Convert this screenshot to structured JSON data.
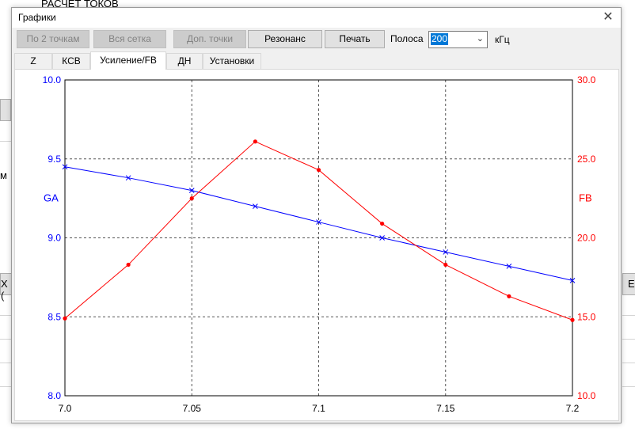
{
  "background_app": {
    "title": "РАСЧЕТ ТОКОВ",
    "fragment_left": "м",
    "fragment_x": "X (",
    "fragment_e": "E"
  },
  "dialog": {
    "title": "Графики",
    "close_icon": "close-icon",
    "toolbar": {
      "by_two_points": "По 2 точкам",
      "whole_grid": "Вся сетка",
      "extra_points": "Доп. точки",
      "resonance": "Резонанс",
      "print": "Печать",
      "band_label": "Полоса",
      "band_value": "200",
      "band_unit": "кГц"
    },
    "tabs": [
      {
        "label": "Z"
      },
      {
        "label": "КСВ"
      },
      {
        "label": "Усиление/FB",
        "active": true
      },
      {
        "label": "ДН"
      },
      {
        "label": "Установки"
      }
    ]
  },
  "chart_data": {
    "type": "line",
    "colors": {
      "ga": "#0000ff",
      "fb": "#ff0000"
    },
    "x": [
      7.0,
      7.025,
      7.05,
      7.075,
      7.1,
      7.125,
      7.15,
      7.175,
      7.2
    ],
    "x_ticks": [
      "7.0",
      "7.05",
      "7.1",
      "7.15",
      "7.2"
    ],
    "x_tick_values": [
      7.0,
      7.05,
      7.1,
      7.15,
      7.2
    ],
    "xlim": [
      7.0,
      7.2
    ],
    "left_axis": {
      "label": "GA",
      "ylim": [
        8.0,
        10.0
      ],
      "ticks": [
        "8.0",
        "8.5",
        "9.0",
        "9.5",
        "10.0"
      ],
      "tick_values": [
        8.0,
        8.5,
        9.0,
        9.5,
        10.0
      ]
    },
    "right_axis": {
      "label": "FB",
      "ylim": [
        10.0,
        30.0
      ],
      "ticks": [
        "10.0",
        "15.0",
        "20.0",
        "25.0",
        "30.0"
      ],
      "tick_values": [
        10.0,
        15.0,
        20.0,
        25.0,
        30.0
      ]
    },
    "series": [
      {
        "name": "GA",
        "axis": "left",
        "marker": "x",
        "values": [
          9.45,
          9.38,
          9.3,
          9.2,
          9.1,
          9.0,
          8.91,
          8.82,
          8.73
        ]
      },
      {
        "name": "FB",
        "axis": "right",
        "marker": "dot",
        "values": [
          14.9,
          18.3,
          22.5,
          26.1,
          24.3,
          20.9,
          18.3,
          16.3,
          14.8
        ]
      }
    ],
    "grid": true
  }
}
